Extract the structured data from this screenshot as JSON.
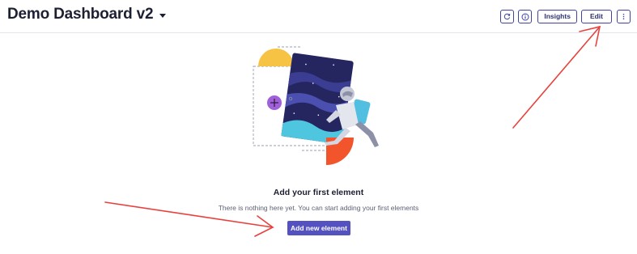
{
  "header": {
    "title": "Demo Dashboard v2",
    "caret_icon": "caret-down-icon"
  },
  "toolbar": {
    "refresh_icon": "refresh-icon",
    "info_icon": "info-icon",
    "insights_label": "Insights",
    "edit_label": "Edit",
    "more_icon": "more-vertical-icon",
    "button_border_color": "#3f44a0"
  },
  "empty_state": {
    "title": "Add your first element",
    "subtitle": "There is nothing here yet. You can start adding your first elements",
    "button_label": "Add new element",
    "button_color": "#5451c0"
  },
  "annotations": {
    "arrow_color": "#e8413c"
  }
}
